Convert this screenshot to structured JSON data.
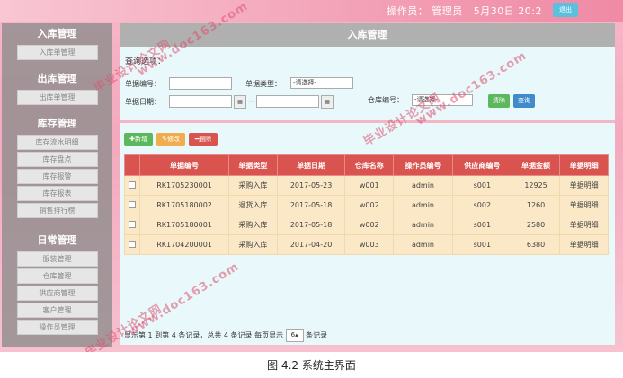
{
  "topbar": {
    "user_label": "操作员： 管理员",
    "time": "5月30日 20:2",
    "logout": "退出"
  },
  "sidebar": {
    "sections": [
      {
        "title": "入库管理",
        "items": [
          "入库单管理"
        ]
      },
      {
        "title": "出库管理",
        "items": [
          "出库单管理"
        ]
      },
      {
        "title": "库存管理",
        "items": [
          "库存流水明细",
          "库存盘点",
          "库存报警",
          "库存报表",
          "销售排行榜"
        ]
      },
      {
        "title": "日常管理",
        "items": [
          "服装管理",
          "仓库管理",
          "供应商管理",
          "客户管理",
          "操作员管理"
        ]
      }
    ]
  },
  "panel": {
    "title": "入库管理",
    "query_title": "查询选项：",
    "labels": {
      "bill_no": "单据编号：",
      "bill_type": "单据类型：",
      "bill_date": "单据日期：",
      "warehouse": "仓库编号：",
      "date_sep": "—"
    },
    "placeholders": {
      "bill_type": "-请选择-",
      "warehouse": "-请选择-"
    },
    "buttons": {
      "clear": "清除",
      "query": "查询",
      "add": "新增",
      "edit": "修改",
      "delete": "删除"
    }
  },
  "table": {
    "headers": [
      "单据编号",
      "单据类型",
      "单据日期",
      "仓库名称",
      "操作员编号",
      "供应商编号",
      "单据金额",
      "单据明细"
    ],
    "rows": [
      [
        "RK1705230001",
        "采购入库",
        "2017-05-23",
        "w001",
        "admin",
        "s001",
        "12925",
        "单据明细"
      ],
      [
        "RK1705180002",
        "退货入库",
        "2017-05-18",
        "w002",
        "admin",
        "s002",
        "1260",
        "单据明细"
      ],
      [
        "RK1705180001",
        "采购入库",
        "2017-05-18",
        "w002",
        "admin",
        "s001",
        "2580",
        "单据明细"
      ],
      [
        "RK1704200001",
        "采购入库",
        "2017-04-20",
        "w003",
        "admin",
        "s001",
        "6380",
        "单据明细"
      ]
    ]
  },
  "pager": {
    "text_before": "显示第 1 到第 4 条记录，总共 4 条记录 每页显示",
    "page_size": "6",
    "text_after": "条记录"
  },
  "watermarks": [
    "毕业设计论文网",
    "www.doc163.com"
  ],
  "caption": "图 4.2 系统主界面",
  "colors": {
    "header_red": "#d9534f",
    "row_bg": "#fbe8c6",
    "add_green": "#5cb85c",
    "edit_orange": "#f0ad4e",
    "delete_red": "#d9534f",
    "query_blue": "#428bca",
    "clear_green": "#5cb85c"
  }
}
